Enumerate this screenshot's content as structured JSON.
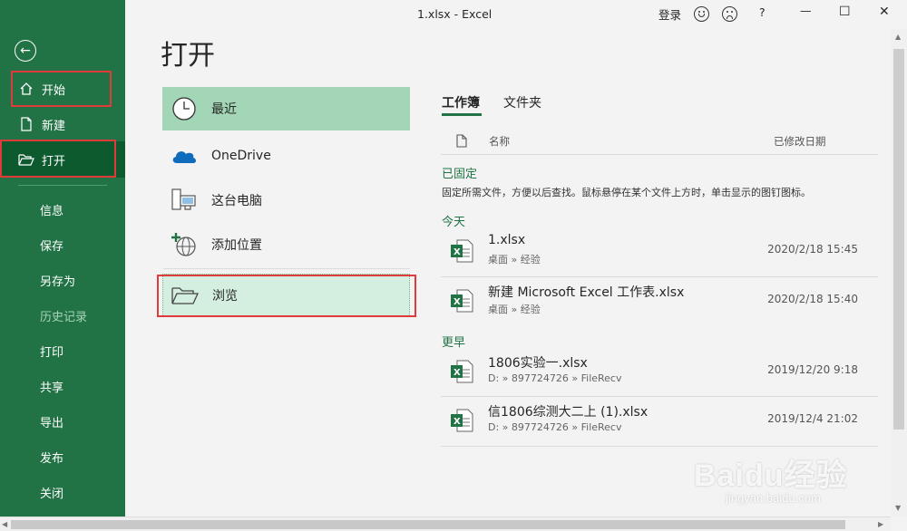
{
  "window": {
    "title": "1.xlsx  -  Excel",
    "login_label": "登录",
    "help_label": "?",
    "minimize_label": "—",
    "maximize_label": "☐",
    "close_label": "✕"
  },
  "nav": {
    "back_label": "←",
    "items": [
      {
        "label": "开始"
      },
      {
        "label": "新建"
      },
      {
        "label": "打开"
      },
      {
        "label": "信息"
      },
      {
        "label": "保存"
      },
      {
        "label": "另存为"
      },
      {
        "label": "历史记录"
      },
      {
        "label": "打印"
      },
      {
        "label": "共享"
      },
      {
        "label": "导出"
      },
      {
        "label": "发布"
      },
      {
        "label": "关闭"
      }
    ]
  },
  "page": {
    "title": "打开"
  },
  "locations": [
    {
      "label": "最近",
      "icon": "clock-icon"
    },
    {
      "label": "OneDrive",
      "icon": "cloud-icon"
    },
    {
      "label": "这台电脑",
      "icon": "computer-icon"
    },
    {
      "label": "添加位置",
      "icon": "add-globe-icon"
    },
    {
      "label": "浏览",
      "icon": "folder-open-icon"
    }
  ],
  "files": {
    "tabs": [
      "工作簿",
      "文件夹"
    ],
    "col_name": "名称",
    "col_date": "已修改日期",
    "pinned_header": "已固定",
    "pinned_hint": "固定所需文件，方便以后查找。鼠标悬停在某个文件上方时，单击显示的图钉图标。",
    "today_header": "今天",
    "earlier_header": "更早",
    "today": [
      {
        "name": "1.xlsx",
        "path": "桌面 » 经验",
        "date": "2020/2/18 15:45"
      },
      {
        "name": "新建 Microsoft Excel 工作表.xlsx",
        "path": "桌面 » 经验",
        "date": "2020/2/18 15:40"
      }
    ],
    "earlier": [
      {
        "name": "1806实验一.xlsx",
        "path": "D: » 897724726 » FileRecv",
        "date": "2019/12/20 9:18"
      },
      {
        "name": "信1806综测大二上 (1).xlsx",
        "path": "D: » 897724726 » FileRecv",
        "date": "2019/12/4 21:02"
      }
    ]
  },
  "watermark": {
    "brand": "Baidu经验",
    "url": "jingyan.baidu.com"
  },
  "colors": {
    "accent": "#217346",
    "highlight": "#e03a3a"
  }
}
